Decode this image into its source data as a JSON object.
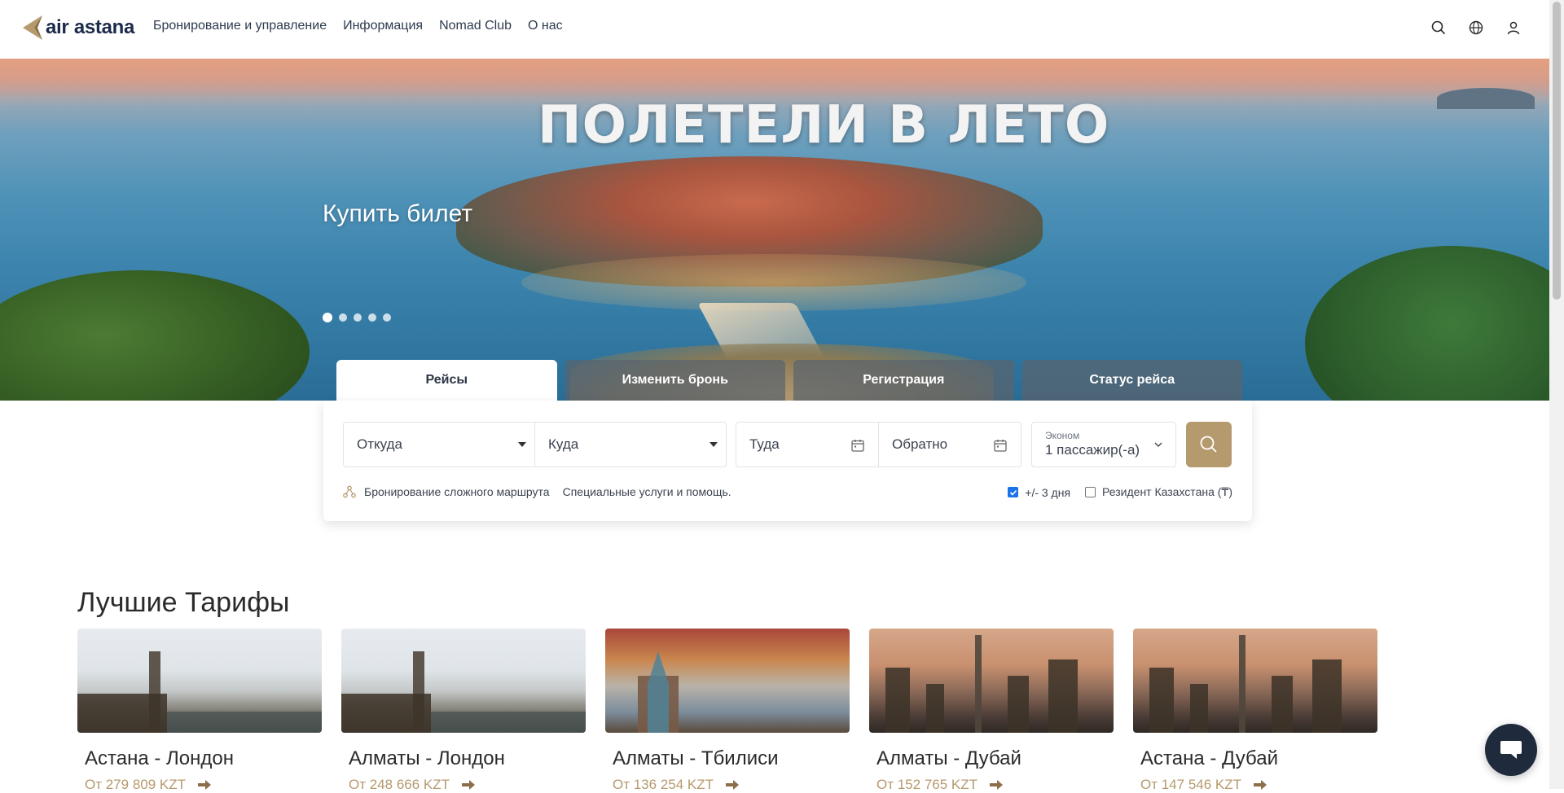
{
  "header": {
    "logo_text": "air astana",
    "nav": [
      {
        "label": "Бронирование и управление"
      },
      {
        "label": "Информация"
      },
      {
        "label": "Nomad Club"
      },
      {
        "label": "О нас"
      }
    ],
    "icons": [
      "search-icon",
      "globe-icon",
      "user-icon"
    ]
  },
  "hero": {
    "headline": "ПОЛЕТЕЛИ В ЛЕТО",
    "cta": "Купить билет",
    "slides_count": 5,
    "active_slide": 1
  },
  "booking": {
    "tabs": [
      {
        "label": "Рейсы",
        "active": true
      },
      {
        "label": "Изменить бронь",
        "active": false
      },
      {
        "label": "Регистрация",
        "active": false
      },
      {
        "label": "Статус рейса",
        "active": false
      }
    ],
    "from_placeholder": "Откуда",
    "to_placeholder": "Куда",
    "depart_placeholder": "Туда",
    "return_placeholder": "Обратно",
    "cabin_class": "Эконом",
    "passengers": "1 пассажир(-а)",
    "complex_route_link": "Бронирование сложного маршрута",
    "special_services_link": "Специальные услуги и помощь.",
    "flex_dates_label": "+/- 3 дня",
    "flex_dates_checked": true,
    "resident_label": "Резидент Казахстана (₸)",
    "resident_checked": false
  },
  "fares": {
    "title": "Лучшие Тарифы",
    "cards": [
      {
        "route": "Астана - Лондон",
        "price": "От 279 809 KZT",
        "image": "london"
      },
      {
        "route": "Алматы - Лондон",
        "price": "От 248 666 KZT",
        "image": "london"
      },
      {
        "route": "Алматы - Тбилиси",
        "price": "От 136 254 KZT",
        "image": "tbilisi"
      },
      {
        "route": "Алматы - Дубай",
        "price": "От 152 765 KZT",
        "image": "dubai"
      },
      {
        "route": "Астана - Дубай",
        "price": "От 147 546 KZT",
        "image": "dubai"
      }
    ]
  },
  "colors": {
    "brand_gold": "#b59a6e",
    "brand_navy": "#1b2a4a",
    "chat_bg": "#1f2a3d"
  }
}
